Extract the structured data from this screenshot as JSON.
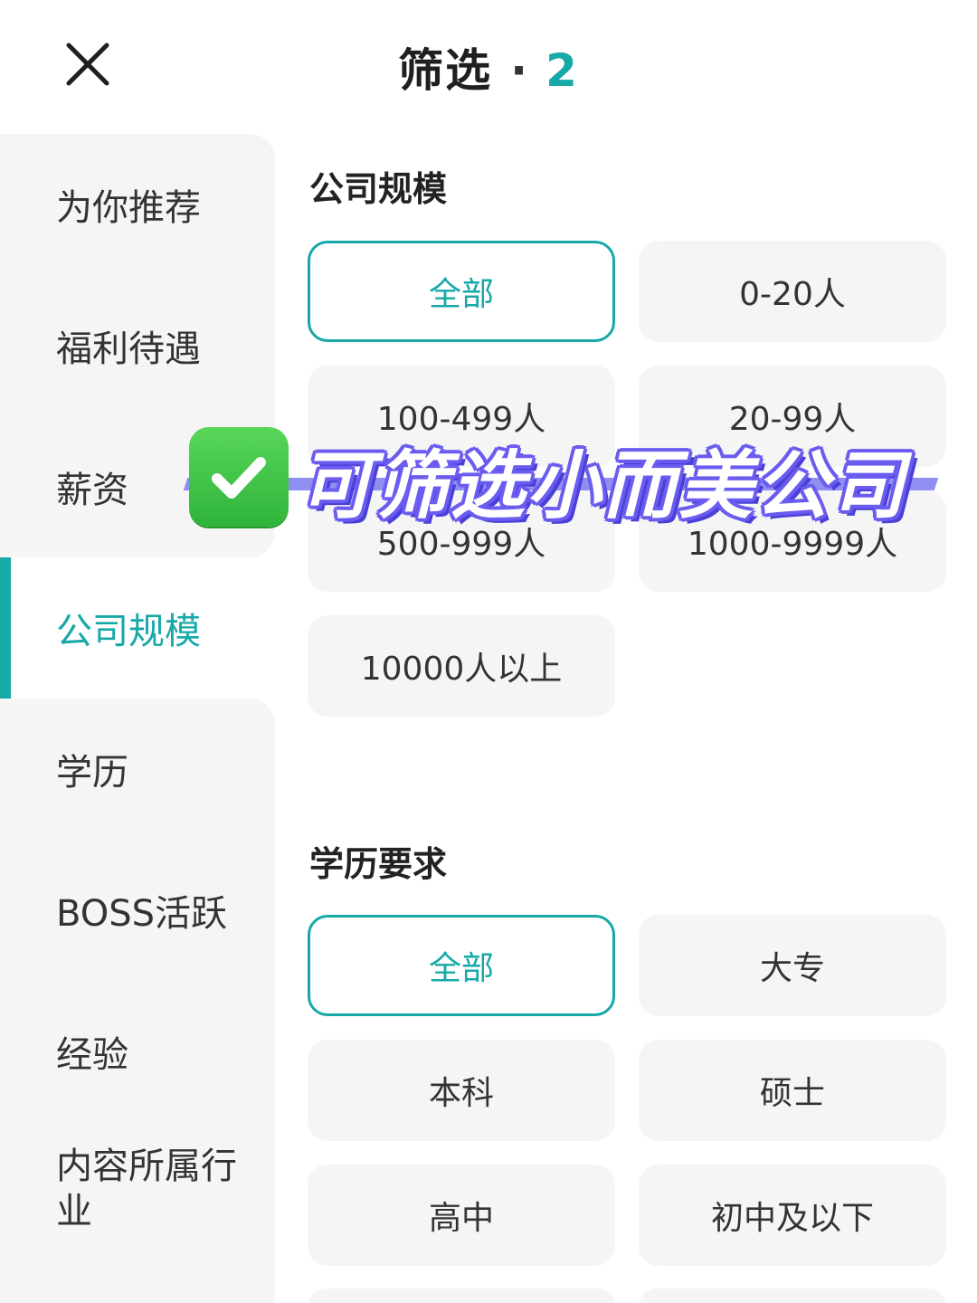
{
  "header": {
    "title": "筛选",
    "dot": "·",
    "count": "2"
  },
  "sidebar": {
    "items": [
      {
        "label": "为你推荐"
      },
      {
        "label": "福利待遇"
      },
      {
        "label": "薪资"
      },
      {
        "label": "公司规模",
        "active": true
      },
      {
        "label": "学历"
      },
      {
        "label": "BOSS活跃"
      },
      {
        "label": "经验"
      },
      {
        "label": "内容所属行业"
      }
    ]
  },
  "sections": {
    "company_size": {
      "title": "公司规模",
      "options": [
        "全部",
        "0-20人",
        "100-499人",
        "20-99人",
        "500-999人",
        "1000-9999人",
        "10000人以上"
      ],
      "selected": "全部"
    },
    "education": {
      "title": "学历要求",
      "options": [
        "全部",
        "大专",
        "本科",
        "硕士",
        "高中",
        "初中及以下"
      ],
      "selected": "全部"
    }
  },
  "overlay": {
    "text": "可筛选小而美公司"
  },
  "colors": {
    "accent": "#17a8a8",
    "chip_bg": "#f5f5f5",
    "sidebar_bg": "#f5f5f5",
    "banner_outline": "#6b5cf0",
    "check_green": "#3cc244"
  },
  "icons": {
    "close": "close-icon",
    "check": "check-mark-icon"
  }
}
